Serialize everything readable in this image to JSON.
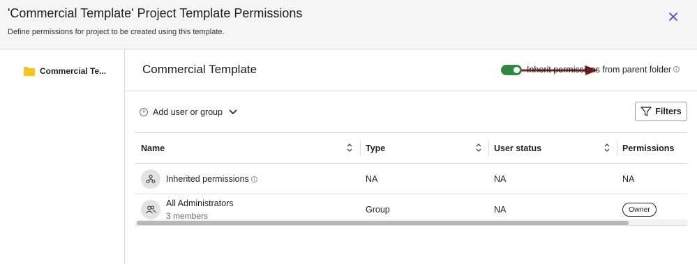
{
  "header": {
    "title": "'Commercial Template' Project Template Permissions",
    "subtitle": "Define permissions for project to be created using this template."
  },
  "sidebar": {
    "folder_label": "Commercial Te..."
  },
  "main": {
    "title": "Commercial Template",
    "inherit_toggle_on": true,
    "inherit_label": "Inherit permissions from parent folder",
    "add_user_label": "Add user or group",
    "filters_label": "Filters"
  },
  "table": {
    "columns": [
      "Name",
      "Type",
      "User status",
      "Permissions"
    ],
    "rows": [
      {
        "name": "Inherited permissions",
        "sub": "",
        "type": "NA",
        "status": "NA",
        "permissions": "NA"
      },
      {
        "name": "All Administrators",
        "sub": "3 members",
        "type": "Group",
        "status": "NA",
        "permissions": "Owner"
      }
    ]
  },
  "colors": {
    "accent": "#6b5fd3",
    "toggle_on": "#2e8b3e",
    "arrow": "#8b1a1a",
    "folder": "#f5c518"
  }
}
